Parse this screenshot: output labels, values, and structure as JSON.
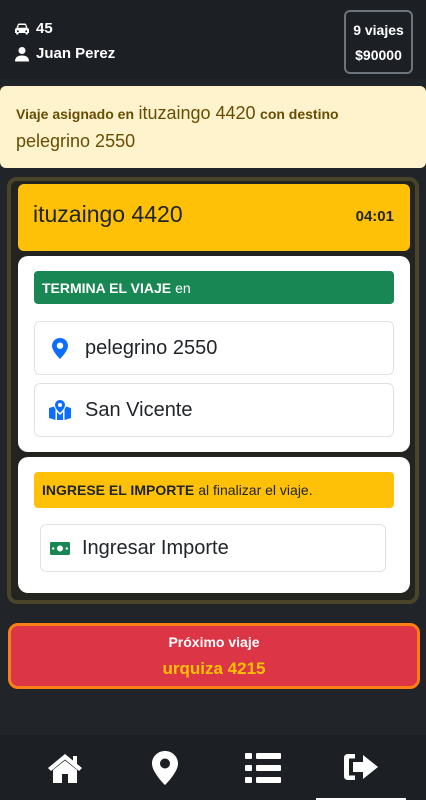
{
  "header": {
    "vehicle_number": "45",
    "driver_name": "Juan Perez",
    "trips_count": "9 viajes",
    "earnings": "$90000"
  },
  "alert": {
    "prefix": "Viaje asignado en",
    "origin": "ituzaingo 4420",
    "middle": "con destino",
    "destination": "pelegrino 2550"
  },
  "current_trip": {
    "origin": "ituzaingo 4420",
    "timer": "04:01",
    "end_header_bold": "TERMINA EL VIAJE",
    "end_header_rest": "en",
    "destination_address": "pelegrino 2550",
    "destination_city": "San Vicente",
    "amount_header_bold": "INGRESE EL IMPORTE",
    "amount_header_rest": "al finalizar el viaje.",
    "amount_placeholder": "Ingresar Importe"
  },
  "next_trip": {
    "label": "Próximo viaje",
    "address": "urquiza 4215"
  },
  "nav": {
    "items": [
      "home-icon",
      "location-icon",
      "list-icon",
      "logout-icon"
    ]
  },
  "colors": {
    "warning": "#ffc107",
    "success": "#198754",
    "danger": "#dc3545",
    "accent_border": "#fd7e14",
    "icon_blue": "#0d6efd"
  }
}
